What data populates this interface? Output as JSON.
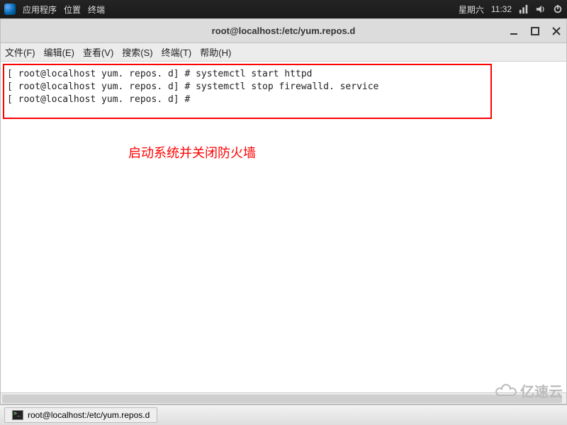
{
  "panel": {
    "apps": "应用程序",
    "places": "位置",
    "terminal": "终端",
    "day": "星期六",
    "time": "11:32"
  },
  "window": {
    "title": "root@localhost:/etc/yum.repos.d"
  },
  "menubar": {
    "file": "文件(F)",
    "edit": "编辑(E)",
    "view": "查看(V)",
    "search": "搜索(S)",
    "terminal": "终端(T)",
    "help": "帮助(H)"
  },
  "terminal": {
    "line1": "[ root@localhost yum. repos. d] # systemctl start httpd",
    "line2": "[ root@localhost yum. repos. d] # systemctl stop firewalld. service",
    "line3": "[ root@localhost yum. repos. d] #"
  },
  "annotation": "启动系统并关闭防火墙",
  "taskbar": {
    "task1": "root@localhost:/etc/yum.repos.d"
  },
  "watermark": "亿速云"
}
